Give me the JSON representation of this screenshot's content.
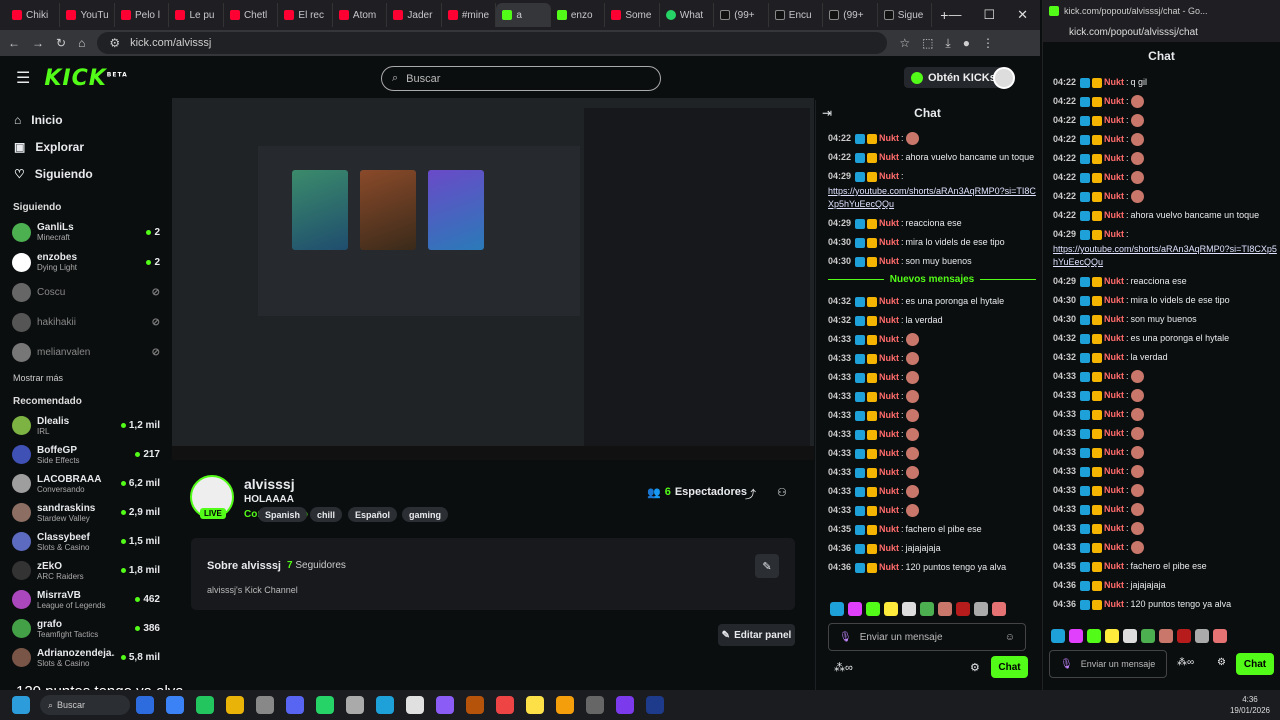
{
  "browser": {
    "tabs": [
      "Chiki",
      "YouTu",
      "Pelo l",
      "Le pu",
      "Chetl",
      "El rec",
      "Atom",
      "Jader",
      "#mine",
      "a",
      "enzo",
      "Some",
      "What",
      "(99+",
      "Encu",
      "(99+",
      "Sigue"
    ],
    "tab_favs": [
      "yt",
      "yt",
      "yt",
      "yt",
      "yt",
      "yt",
      "yt",
      "yt",
      "yt",
      "kick",
      "kick",
      "yt",
      "wa",
      "tt",
      "tt",
      "tt",
      "tt"
    ],
    "new_tab": "+",
    "url": "kick.com/alvisssj"
  },
  "header": {
    "logo": "KICK",
    "logo_badge": "BETA",
    "search_placeholder": "Buscar",
    "kicks_button": "Obtén KICKs"
  },
  "nav": [
    {
      "label": "Inicio",
      "icon": "home-icon",
      "glyph": "⌂"
    },
    {
      "label": "Explorar",
      "icon": "explore-icon",
      "glyph": "▣"
    },
    {
      "label": "Siguiendo",
      "icon": "heart-icon",
      "glyph": "♡"
    }
  ],
  "following": {
    "heading": "Siguiendo",
    "channels": [
      {
        "name": "GanliLs",
        "sub": "Minecraft",
        "count": "2",
        "color": "#4caf50",
        "online": true
      },
      {
        "name": "enzobes",
        "sub": "Dying Light",
        "count": "2",
        "color": "#ffffff",
        "online": true
      },
      {
        "name": "Coscu",
        "sub": "",
        "count": "",
        "color": "#666666",
        "online": false
      },
      {
        "name": "hakihakii",
        "sub": "",
        "count": "",
        "color": "#555555",
        "online": false
      },
      {
        "name": "melianvalen",
        "sub": "",
        "count": "",
        "color": "#777777",
        "online": false
      }
    ],
    "show_more": "Mostrar más"
  },
  "recommended": {
    "heading": "Recomendado",
    "channels": [
      {
        "name": "Dlealis",
        "sub": "IRL",
        "count": "1,2 mil",
        "color": "#7cb342"
      },
      {
        "name": "BoffeGP",
        "sub": "Side Effects",
        "count": "217",
        "color": "#3f51b5"
      },
      {
        "name": "LACOBRAAA",
        "sub": "Conversando",
        "count": "6,2 mil",
        "color": "#9e9e9e"
      },
      {
        "name": "sandraskins",
        "sub": "Stardew Valley",
        "count": "2,9 mil",
        "color": "#8d6e63"
      },
      {
        "name": "Classybeef",
        "sub": "Slots & Casino",
        "count": "1,5 mil",
        "color": "#5c6bc0"
      },
      {
        "name": "zEkO",
        "sub": "ARC Raiders",
        "count": "1,8 mil",
        "color": "#333333"
      },
      {
        "name": "MisrraVB",
        "sub": "League of Legends",
        "count": "462",
        "color": "#ab47bc"
      },
      {
        "name": "grafo",
        "sub": "Teamfight Tactics",
        "count": "386",
        "color": "#43a047"
      },
      {
        "name": "Adrianozendeja...",
        "sub": "Slots & Casino",
        "count": "5,8 mil",
        "color": "#795548"
      }
    ]
  },
  "channel": {
    "name": "alvisssj",
    "title": "HOLAAAA",
    "category": "Conversando",
    "live": "LIVE",
    "tags": [
      "Spanish",
      "chill",
      "Español",
      "gaming"
    ],
    "viewers_count": "6",
    "viewers_label": "Espectadores",
    "about_title": "Sobre alvisssj",
    "followers_count": "7",
    "followers_label": "Seguidores",
    "description": "alvisssj's Kick Channel",
    "edit_panel": "Editar panel"
  },
  "caption": "120 puntos tengo ya alva",
  "chat": {
    "title": "Chat",
    "user": "Nukt",
    "new_messages": "Nuevos mensajes",
    "messages_before": [
      {
        "time": "04:22",
        "text": "",
        "emote": true
      },
      {
        "time": "04:22",
        "text": "ahora vuelvo bancame un toque",
        "emote": false
      },
      {
        "time": "04:29",
        "text": "",
        "link": "https://youtube.com/shorts/aRAn3AqRMP0?si=TI8CXp5hYuEecQQu",
        "emote": false
      },
      {
        "time": "04:29",
        "text": "reacciona ese",
        "emote": false
      },
      {
        "time": "04:30",
        "text": "mira lo videls de ese tipo",
        "emote": false
      },
      {
        "time": "04:30",
        "text": "son muy buenos",
        "emote": false
      }
    ],
    "messages_after": [
      {
        "time": "04:32",
        "text": "es una poronga el hytale",
        "emote": false
      },
      {
        "time": "04:32",
        "text": "la verdad",
        "emote": false
      },
      {
        "time": "04:33",
        "text": "",
        "emote": true
      },
      {
        "time": "04:33",
        "text": "",
        "emote": true
      },
      {
        "time": "04:33",
        "text": "",
        "emote": true
      },
      {
        "time": "04:33",
        "text": "",
        "emote": true
      },
      {
        "time": "04:33",
        "text": "",
        "emote": true
      },
      {
        "time": "04:33",
        "text": "",
        "emote": true
      },
      {
        "time": "04:33",
        "text": "",
        "emote": true
      },
      {
        "time": "04:33",
        "text": "",
        "emote": true
      },
      {
        "time": "04:33",
        "text": "",
        "emote": true
      },
      {
        "time": "04:33",
        "text": "",
        "emote": true
      },
      {
        "time": "04:35",
        "text": "fachero el pibe ese",
        "emote": false
      },
      {
        "time": "04:36",
        "text": "jajajajaja",
        "emote": false
      },
      {
        "time": "04:36",
        "text": "120 puntos tengo ya alva",
        "emote": false
      }
    ],
    "input_placeholder": "Enviar un mensaje",
    "send": "Chat",
    "emote_colors": [
      "#1ea1d8",
      "#e040fb",
      "#53fc18",
      "#ffeb3b",
      "#ddd",
      "#4caf50",
      "#c9776a",
      "#b71c1c",
      "#aaa",
      "#e57373"
    ]
  },
  "popout": {
    "window_title": "kick.com/popout/alvisssj/chat - Go...",
    "url": "kick.com/popout/alvisssj/chat",
    "title": "Chat",
    "messages": [
      {
        "time": "04:22",
        "text": "q gil",
        "emote": false
      },
      {
        "time": "04:22",
        "text": "",
        "emote": true
      },
      {
        "time": "04:22",
        "text": "",
        "emote": true
      },
      {
        "time": "04:22",
        "text": "",
        "emote": true
      },
      {
        "time": "04:22",
        "text": "",
        "emote": true
      },
      {
        "time": "04:22",
        "text": "",
        "emote": true
      },
      {
        "time": "04:22",
        "text": "",
        "emote": true
      },
      {
        "time": "04:22",
        "text": "ahora vuelvo bancame un toque",
        "emote": false
      },
      {
        "time": "04:29",
        "text": "",
        "link": "https://youtube.com/shorts/aRAn3AqRMP0?si=TI8CXp5hYuEecQQu",
        "emote": false
      },
      {
        "time": "04:29",
        "text": "reacciona ese",
        "emote": false
      },
      {
        "time": "04:30",
        "text": "mira lo videls de ese tipo",
        "emote": false
      },
      {
        "time": "04:30",
        "text": "son muy buenos",
        "emote": false
      },
      {
        "time": "04:32",
        "text": "es una poronga el hytale",
        "emote": false
      },
      {
        "time": "04:32",
        "text": "la verdad",
        "emote": false
      },
      {
        "time": "04:33",
        "text": "",
        "emote": true
      },
      {
        "time": "04:33",
        "text": "",
        "emote": true
      },
      {
        "time": "04:33",
        "text": "",
        "emote": true
      },
      {
        "time": "04:33",
        "text": "",
        "emote": true
      },
      {
        "time": "04:33",
        "text": "",
        "emote": true
      },
      {
        "time": "04:33",
        "text": "",
        "emote": true
      },
      {
        "time": "04:33",
        "text": "",
        "emote": true
      },
      {
        "time": "04:33",
        "text": "",
        "emote": true
      },
      {
        "time": "04:33",
        "text": "",
        "emote": true
      },
      {
        "time": "04:33",
        "text": "",
        "emote": true
      },
      {
        "time": "04:35",
        "text": "fachero el pibe ese",
        "emote": false
      },
      {
        "time": "04:36",
        "text": "jajajajaja",
        "emote": false
      },
      {
        "time": "04:36",
        "text": "120 puntos tengo ya alva",
        "emote": false
      }
    ],
    "input_placeholder": "Enviar un mensaje",
    "send": "Chat"
  },
  "taskbar": {
    "search": "Buscar",
    "time": "4:36",
    "date": "19/01/2026",
    "apps": [
      "#2d6cdf",
      "#3b82f6",
      "#22c55e",
      "#eab308",
      "#888",
      "#5865f2",
      "#25d366",
      "#aaa",
      "#1ea1d8",
      "#e0e0e0",
      "#8b5cf6",
      "#b45309",
      "#ef4444",
      "#fde047",
      "#f59e0b",
      "#666",
      "#7c3aed",
      "#1e3a8a"
    ]
  }
}
